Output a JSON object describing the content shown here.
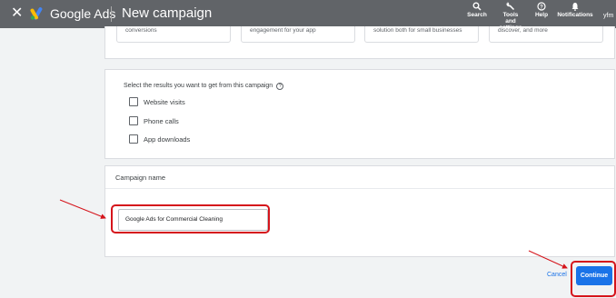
{
  "header": {
    "close_glyph": "✕",
    "product": "Google Ads",
    "page_title": "New campaign",
    "tools": [
      {
        "label": "Search",
        "icon": "search-icon"
      },
      {
        "label": "Tools and settings",
        "icon": "wrench-icon"
      },
      {
        "label": "Help",
        "icon": "help-icon"
      },
      {
        "label": "Notifications",
        "icon": "bell-icon"
      }
    ],
    "account": "yfm"
  },
  "goals": [
    "conversions",
    "engagement for your app",
    "solution both for small businesses",
    "discover, and more"
  ],
  "results": {
    "title": "Select the results you want to get from this campaign",
    "help_glyph": "?",
    "options": [
      {
        "label": "Website visits",
        "checked": false
      },
      {
        "label": "Phone calls",
        "checked": false
      },
      {
        "label": "App downloads",
        "checked": false
      }
    ]
  },
  "campaign_name": {
    "header": "Campaign name",
    "value": "Google Ads for Commercial Cleaning"
  },
  "actions": {
    "cancel": "Cancel",
    "continue": "Continue"
  },
  "colors": {
    "accent": "#1a73e8",
    "highlight": "#d5141b",
    "topbar": "#616468"
  }
}
